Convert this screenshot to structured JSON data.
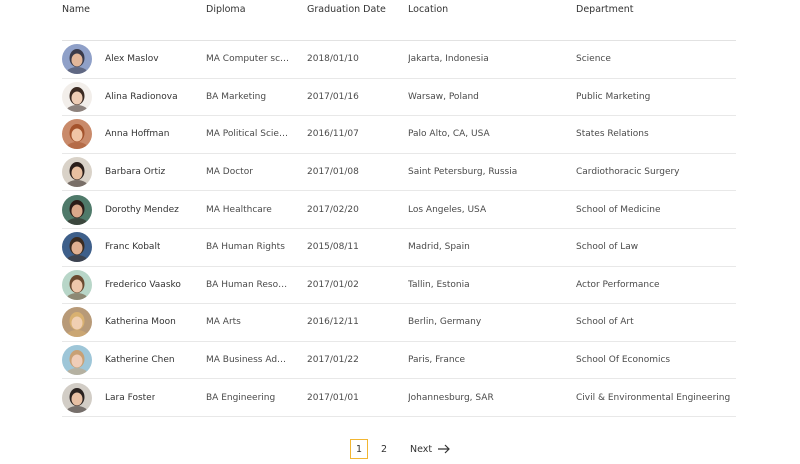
{
  "table": {
    "headers": {
      "name": "Name",
      "diploma": "Diploma",
      "graduation_date": "Graduation Date",
      "location": "Location",
      "department": "Department"
    },
    "rows": [
      {
        "name": "Alex Maslov",
        "diploma": "MA Computer scie...",
        "date": "2018/01/10",
        "location": "Jakarta, Indonesia",
        "department": "Science",
        "avatar": {
          "bg": "#8fa0c8",
          "skin": "#e3b79a",
          "hair": "#3a3a4a"
        }
      },
      {
        "name": "Alina Radionova",
        "diploma": "BA Marketing",
        "date": "2017/01/16",
        "location": "Warsaw, Poland",
        "department": "Public Marketing",
        "avatar": {
          "bg": "#f2eeea",
          "skin": "#efcdb5",
          "hair": "#3b2a22"
        }
      },
      {
        "name": "Anna Hoffman",
        "diploma": "MA Political Science",
        "date": "2016/11/07",
        "location": "Palo Alto, CA, USA",
        "department": "States Relations",
        "avatar": {
          "bg": "#c98a6a",
          "skin": "#f0c5a6",
          "hair": "#a4532c"
        }
      },
      {
        "name": "Barbara Ortiz",
        "diploma": "MA Doctor",
        "date": "2017/01/08",
        "location": "Saint Petersburg, Russia",
        "department": "Cardiothoracic Surgery",
        "avatar": {
          "bg": "#d9d2c8",
          "skin": "#e8bfa0",
          "hair": "#2a1e1a"
        }
      },
      {
        "name": "Dorothy Mendez",
        "diploma": "MA Healthcare",
        "date": "2017/02/20",
        "location": "Los Angeles, USA",
        "department": "School of Medicine",
        "avatar": {
          "bg": "#4f7a6a",
          "skin": "#d9a88a",
          "hair": "#2b1d18"
        }
      },
      {
        "name": "Franc Kobalt",
        "diploma": "BA Human Rights",
        "date": "2015/08/11",
        "location": "Madrid, Spain",
        "department": "School of Law",
        "avatar": {
          "bg": "#3e5f8a",
          "skin": "#e0b092",
          "hair": "#3a2b20"
        }
      },
      {
        "name": "Frederico Vaasko",
        "diploma": "BA Human Resour...",
        "date": "2017/01/02",
        "location": "Tallin, Estonia",
        "department": "Actor Performance",
        "avatar": {
          "bg": "#b8d6c8",
          "skin": "#edc8ac",
          "hair": "#6a4a30"
        }
      },
      {
        "name": "Katherina Moon",
        "diploma": "MA Arts",
        "date": "2016/12/11",
        "location": "Berlin, Germany",
        "department": "School of Art",
        "avatar": {
          "bg": "#b89a78",
          "skin": "#f0cfb2",
          "hair": "#d8b070"
        }
      },
      {
        "name": "Katherine Chen",
        "diploma": "MA Business Admi...",
        "date": "2017/01/22",
        "location": "Paris, France",
        "department": "School Of Economics",
        "avatar": {
          "bg": "#9ec6d8",
          "skin": "#efcdb8",
          "hair": "#c8a074"
        }
      },
      {
        "name": "Lara Foster",
        "diploma": "BA Engineering",
        "date": "2017/01/01",
        "location": "Johannesburg, SAR",
        "department": "Civil & Environmental Engineering",
        "avatar": {
          "bg": "#d2cdc6",
          "skin": "#e8c0a4",
          "hair": "#2a2220"
        }
      }
    ]
  },
  "pagination": {
    "current_page": "1",
    "page_2": "2",
    "next_label": "Next",
    "accent": "#f2b632"
  }
}
